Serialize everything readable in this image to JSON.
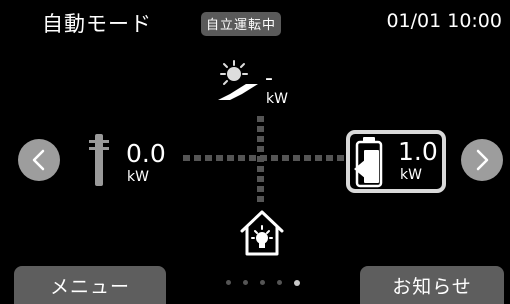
{
  "header": {
    "mode_title": "自動モード",
    "status_badge": "自立運転中",
    "datetime": "01/01 10:00"
  },
  "solar": {
    "value": "-",
    "unit": "kW",
    "icon": "solar-panel-icon"
  },
  "grid": {
    "value": "0.0",
    "unit": "kW",
    "icon": "power-pole-icon"
  },
  "battery": {
    "value": "1.0",
    "unit": "kW",
    "icon": "battery-discharge-icon"
  },
  "home": {
    "icon": "house-icon"
  },
  "nav": {
    "prev_icon": "chevron-left-icon",
    "next_icon": "chevron-right-icon"
  },
  "footer": {
    "menu_label": "メニュー",
    "notice_label": "お知らせ",
    "pages": 5,
    "active_page": 5
  }
}
